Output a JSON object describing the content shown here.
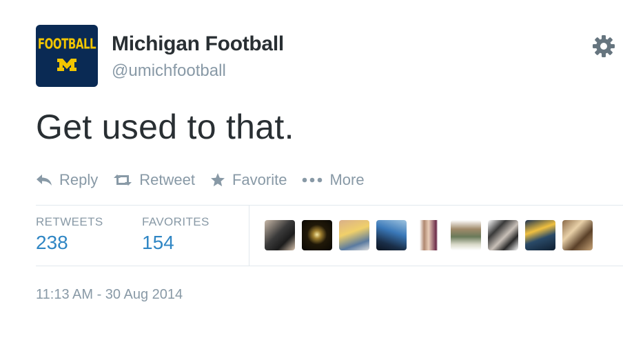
{
  "account": {
    "avatar_text": "FOOTBALL",
    "name": "Michigan Football",
    "handle": "@umichfootball"
  },
  "tweet": {
    "text": "Get used to that."
  },
  "actions": [
    {
      "label": "Reply",
      "icon": "reply-icon"
    },
    {
      "label": "Retweet",
      "icon": "retweet-icon"
    },
    {
      "label": "Favorite",
      "icon": "star-icon"
    },
    {
      "label": "More",
      "icon": "more-dots-icon"
    }
  ],
  "stats": {
    "retweets_label": "RETWEETS",
    "retweets_count": "238",
    "favorites_label": "FAVORITES",
    "favorites_count": "154"
  },
  "favoriter_avatars": 9,
  "timestamp": "11:13 AM - 30 Aug 2014",
  "colors": {
    "name": "#292f33",
    "muted": "#8899a6",
    "count": "#2f86c4",
    "divider": "#e1e8ed",
    "avatar_bg": "#0a2a54",
    "avatar_text": "#f2c500"
  }
}
